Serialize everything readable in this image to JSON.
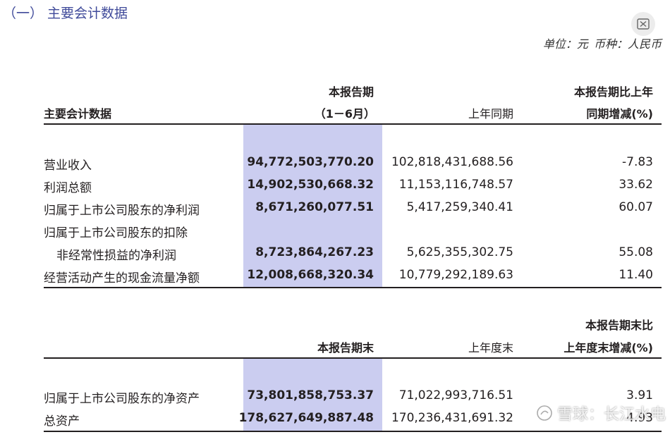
{
  "section_title": "（一）  主要会计数据",
  "units_text": "单位：元    币种：人民币",
  "icons": {
    "close": "close-x-icon",
    "watermark_logo": "snowball-logo-icon"
  },
  "colors": {
    "highlight": "#cbcdf0",
    "title": "#3f4a9a"
  },
  "table1": {
    "headers": {
      "label": "主要会计数据",
      "current_line1": "本报告期",
      "current_line2": "（1－6月）",
      "prior": "上年同期",
      "change_line1": "本报告期比上年",
      "change_line2": "同期增减(%)"
    },
    "rows": [
      {
        "label": "营业收入",
        "current": "94,772,503,770.20",
        "prior": "102,818,431,688.56",
        "change": "-7.83"
      },
      {
        "label": "利润总额",
        "current": "14,902,530,668.32",
        "prior": "11,153,116,748.57",
        "change": "33.62"
      },
      {
        "label": "归属于上市公司股东的净利润",
        "current": "8,671,260,077.51",
        "prior": "5,417,259,340.41",
        "change": "60.07"
      },
      {
        "label": "归属于上市公司股东的扣除",
        "current": "",
        "prior": "",
        "change": ""
      },
      {
        "label": "非经常性损益的净利润",
        "current": "8,723,864,267.23",
        "prior": "5,625,355,302.75",
        "change": "55.08"
      },
      {
        "label": "经营活动产生的现金流量净额",
        "current": "12,008,668,320.34",
        "prior": "10,779,292,189.63",
        "change": "11.40"
      }
    ]
  },
  "table2": {
    "headers": {
      "current": "本报告期末",
      "prior": "上年度末",
      "change_line1": "本报告期末比",
      "change_line2": "上年度末增减(%)"
    },
    "rows": [
      {
        "label": "归属于上市公司股东的净资产",
        "current": "73,801,858,753.37",
        "prior": "71,022,993,716.51",
        "change": "3.91"
      },
      {
        "label": "总资产",
        "current": "178,627,649,887.48",
        "prior": "170,236,431,691.32",
        "change": "4.93"
      }
    ]
  },
  "watermark": "雪球：长江水电"
}
